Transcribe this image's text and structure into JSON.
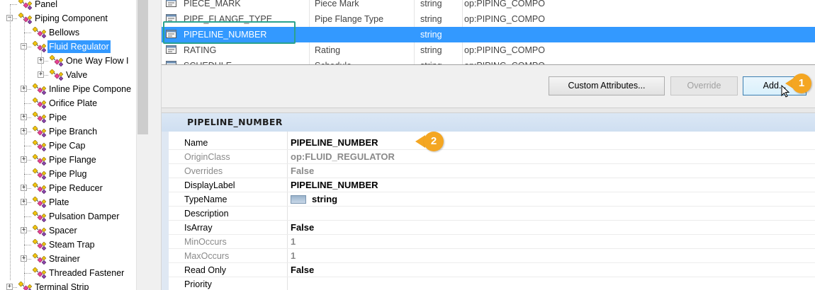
{
  "tree": {
    "items": [
      {
        "label": "Panel",
        "level": 1,
        "expander": "",
        "selected": false
      },
      {
        "label": "Piping Component",
        "level": 1,
        "expander": "-",
        "selected": false
      },
      {
        "label": "Bellows",
        "level": 2,
        "expander": "",
        "selected": false
      },
      {
        "label": "Fluid Regulator",
        "level": 2,
        "expander": "-",
        "selected": true
      },
      {
        "label": "One Way Flow I",
        "level": 3,
        "expander": "+",
        "selected": false
      },
      {
        "label": "Valve",
        "level": 3,
        "expander": "+",
        "selected": false
      },
      {
        "label": "Inline Pipe Compone",
        "level": 2,
        "expander": "+",
        "selected": false
      },
      {
        "label": "Orifice Plate",
        "level": 2,
        "expander": "",
        "selected": false
      },
      {
        "label": "Pipe",
        "level": 2,
        "expander": "+",
        "selected": false
      },
      {
        "label": "Pipe Branch",
        "level": 2,
        "expander": "+",
        "selected": false
      },
      {
        "label": "Pipe Cap",
        "level": 2,
        "expander": "",
        "selected": false
      },
      {
        "label": "Pipe Flange",
        "level": 2,
        "expander": "+",
        "selected": false
      },
      {
        "label": "Pipe Plug",
        "level": 2,
        "expander": "",
        "selected": false
      },
      {
        "label": "Pipe Reducer",
        "level": 2,
        "expander": "+",
        "selected": false
      },
      {
        "label": "Plate",
        "level": 2,
        "expander": "+",
        "selected": false
      },
      {
        "label": "Pulsation Damper",
        "level": 2,
        "expander": "",
        "selected": false
      },
      {
        "label": "Spacer",
        "level": 2,
        "expander": "+",
        "selected": false
      },
      {
        "label": "Steam Trap",
        "level": 2,
        "expander": "",
        "selected": false
      },
      {
        "label": "Strainer",
        "level": 2,
        "expander": "+",
        "selected": false
      },
      {
        "label": "Threaded Fastener",
        "level": 2,
        "expander": "",
        "selected": false
      },
      {
        "label": "Terminal Strip",
        "level": 1,
        "expander": "+",
        "selected": false
      }
    ]
  },
  "property_grid": {
    "rows": [
      {
        "name": "PIECE_MARK",
        "label": "Piece Mark",
        "type": "string",
        "class": "op:PIPING_COMPO",
        "selected": false
      },
      {
        "name": "PIPE_FLANGE_TYPE",
        "label": "Pipe Flange Type",
        "type": "string",
        "class": "op:PIPING_COMPO",
        "selected": false
      },
      {
        "name": "PIPELINE_NUMBER",
        "label": "",
        "type": "string",
        "class": "",
        "selected": true
      },
      {
        "name": "RATING",
        "label": "Rating",
        "type": "string",
        "class": "op:PIPING_COMPO",
        "selected": false
      },
      {
        "name": "SCHEDULE",
        "label": "Schedule",
        "type": "string",
        "class": "op:PIPING_COMPO",
        "selected": false
      }
    ]
  },
  "buttons": {
    "custom_attributes": "Custom Attributes...",
    "override": "Override",
    "add": "Add..."
  },
  "callouts": {
    "first": "1",
    "second": "2"
  },
  "details": {
    "title": "PIPELINE_NUMBER",
    "rows": [
      {
        "key": "Name",
        "value": "PIPELINE_NUMBER",
        "dim": false
      },
      {
        "key": "OriginClass",
        "value": "op:FLUID_REGULATOR",
        "dim": true
      },
      {
        "key": "Overrides",
        "value": "False",
        "dim": true
      },
      {
        "key": "DisplayLabel",
        "value": "PIPELINE_NUMBER",
        "dim": false
      },
      {
        "key": "TypeName",
        "value": "string",
        "dim": false
      },
      {
        "key": "Description",
        "value": "",
        "dim": false
      },
      {
        "key": "IsArray",
        "value": "False",
        "dim": false
      },
      {
        "key": "MinOccurs",
        "value": "1",
        "dim": true
      },
      {
        "key": "MaxOccurs",
        "value": "1",
        "dim": true
      },
      {
        "key": "Read Only",
        "value": "False",
        "dim": false
      },
      {
        "key": "Priority",
        "value": "",
        "dim": false
      }
    ]
  },
  "colors": {
    "selection": "#3399ff",
    "highlight_box": "#2aa28e",
    "callout": "#f4a622",
    "details_header": "#d4e3f3"
  }
}
